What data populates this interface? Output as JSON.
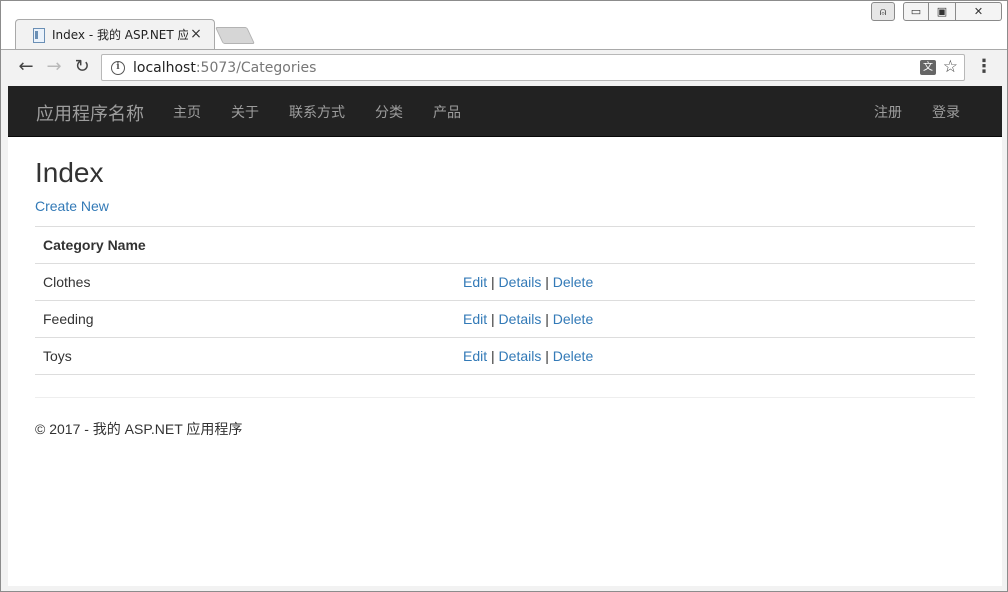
{
  "browser": {
    "tab_title": "Index - 我的 ASP.NET 应",
    "tab_close": "×",
    "url_host": "localhost",
    "url_rest": ":5073/Categories",
    "window_controls": {
      "user": "⍝",
      "minimize": "▭",
      "maximize": "▣",
      "close": "✕"
    },
    "icons": {
      "back": "←",
      "forward": "→",
      "reload": "↻",
      "info": "i",
      "translate": "文",
      "star": "☆",
      "menu": "⋮"
    }
  },
  "navbar": {
    "brand": "应用程序名称",
    "items": [
      "主页",
      "关于",
      "联系方式",
      "分类",
      "产品"
    ],
    "right_items": [
      "注册",
      "登录"
    ]
  },
  "main": {
    "title": "Index",
    "create_link": "Create New",
    "table": {
      "header": "Category Name",
      "rows": [
        {
          "name": "Clothes"
        },
        {
          "name": "Feeding"
        },
        {
          "name": "Toys"
        }
      ],
      "actions": {
        "edit": "Edit",
        "details": "Details",
        "delete": "Delete",
        "separator": "|"
      }
    }
  },
  "footer": {
    "text": "© 2017 - 我的 ASP.NET 应用程序"
  },
  "colors": {
    "navbar_bg": "#222222",
    "nav_text": "#9d9d9d",
    "link": "#337ab7",
    "rule": "#dddddd"
  }
}
